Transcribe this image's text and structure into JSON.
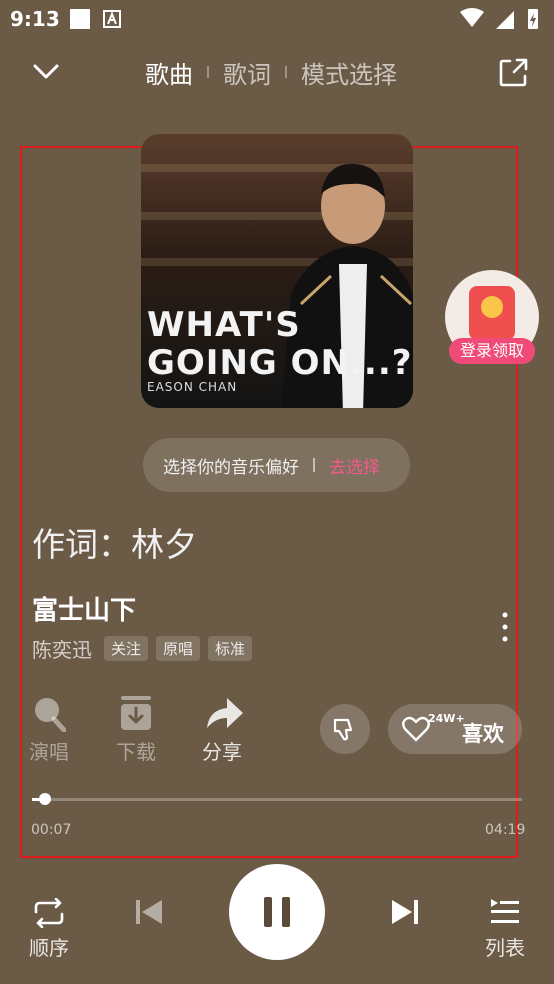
{
  "status_bar": {
    "time": "9:13"
  },
  "header": {
    "tabs": [
      {
        "label": "歌曲",
        "active": true
      },
      {
        "label": "歌词",
        "active": false
      },
      {
        "label": "模式选择",
        "active": false
      }
    ]
  },
  "cover": {
    "title_line1": "WHAT'S",
    "title_line2": "GOING ON...?",
    "artist": "EASON CHAN"
  },
  "promo": {
    "label": "登录领取"
  },
  "preference": {
    "text": "选择你的音乐偏好",
    "link": "去选择"
  },
  "lyric": {
    "current_line": "作词：林夕"
  },
  "song": {
    "title": "富士山下",
    "artist": "陈奕迅",
    "badges": [
      "关注",
      "原唱",
      "标准"
    ]
  },
  "actions": {
    "sing_label": "演唱",
    "download_label": "下载",
    "share_label": "分享",
    "like_count": "24W+",
    "like_label": "喜欢"
  },
  "progress": {
    "current": "00:07",
    "total": "04:19",
    "fraction": 0.027
  },
  "controls": {
    "mode_label": "顺序",
    "list_label": "列表"
  },
  "colors": {
    "background": "#6b5a46",
    "accent_pink": "#f35a8b",
    "highlight_border": "#e01b1b"
  }
}
